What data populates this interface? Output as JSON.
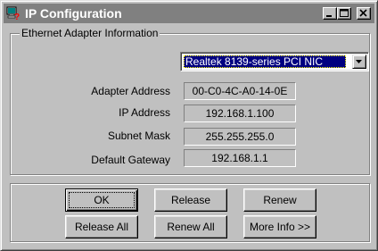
{
  "window": {
    "title": "IP Configuration",
    "buttons": [
      "minimize",
      "maximize",
      "close"
    ]
  },
  "adapter_group": {
    "label": "Ethernet  Adapter Information",
    "adapter_select": {
      "selected": "Realtek 8139-series PCI NIC"
    },
    "fields": [
      {
        "label": "Adapter Address",
        "value": "00-C0-4C-A0-14-0E"
      },
      {
        "label": "IP Address",
        "value": "192.168.1.100"
      },
      {
        "label": "Subnet Mask",
        "value": "255.255.255.0"
      },
      {
        "label": "Default Gateway",
        "value": "192.168.1.1"
      }
    ]
  },
  "actions": {
    "ok": "OK",
    "release": "Release",
    "renew": "Renew",
    "release_all": "Release All",
    "renew_all": "Renew All",
    "more_info": "More Info >>"
  },
  "colors": {
    "face": "#c0c0c0",
    "titlebar_inactive": "#808080",
    "highlight": "#000080"
  }
}
